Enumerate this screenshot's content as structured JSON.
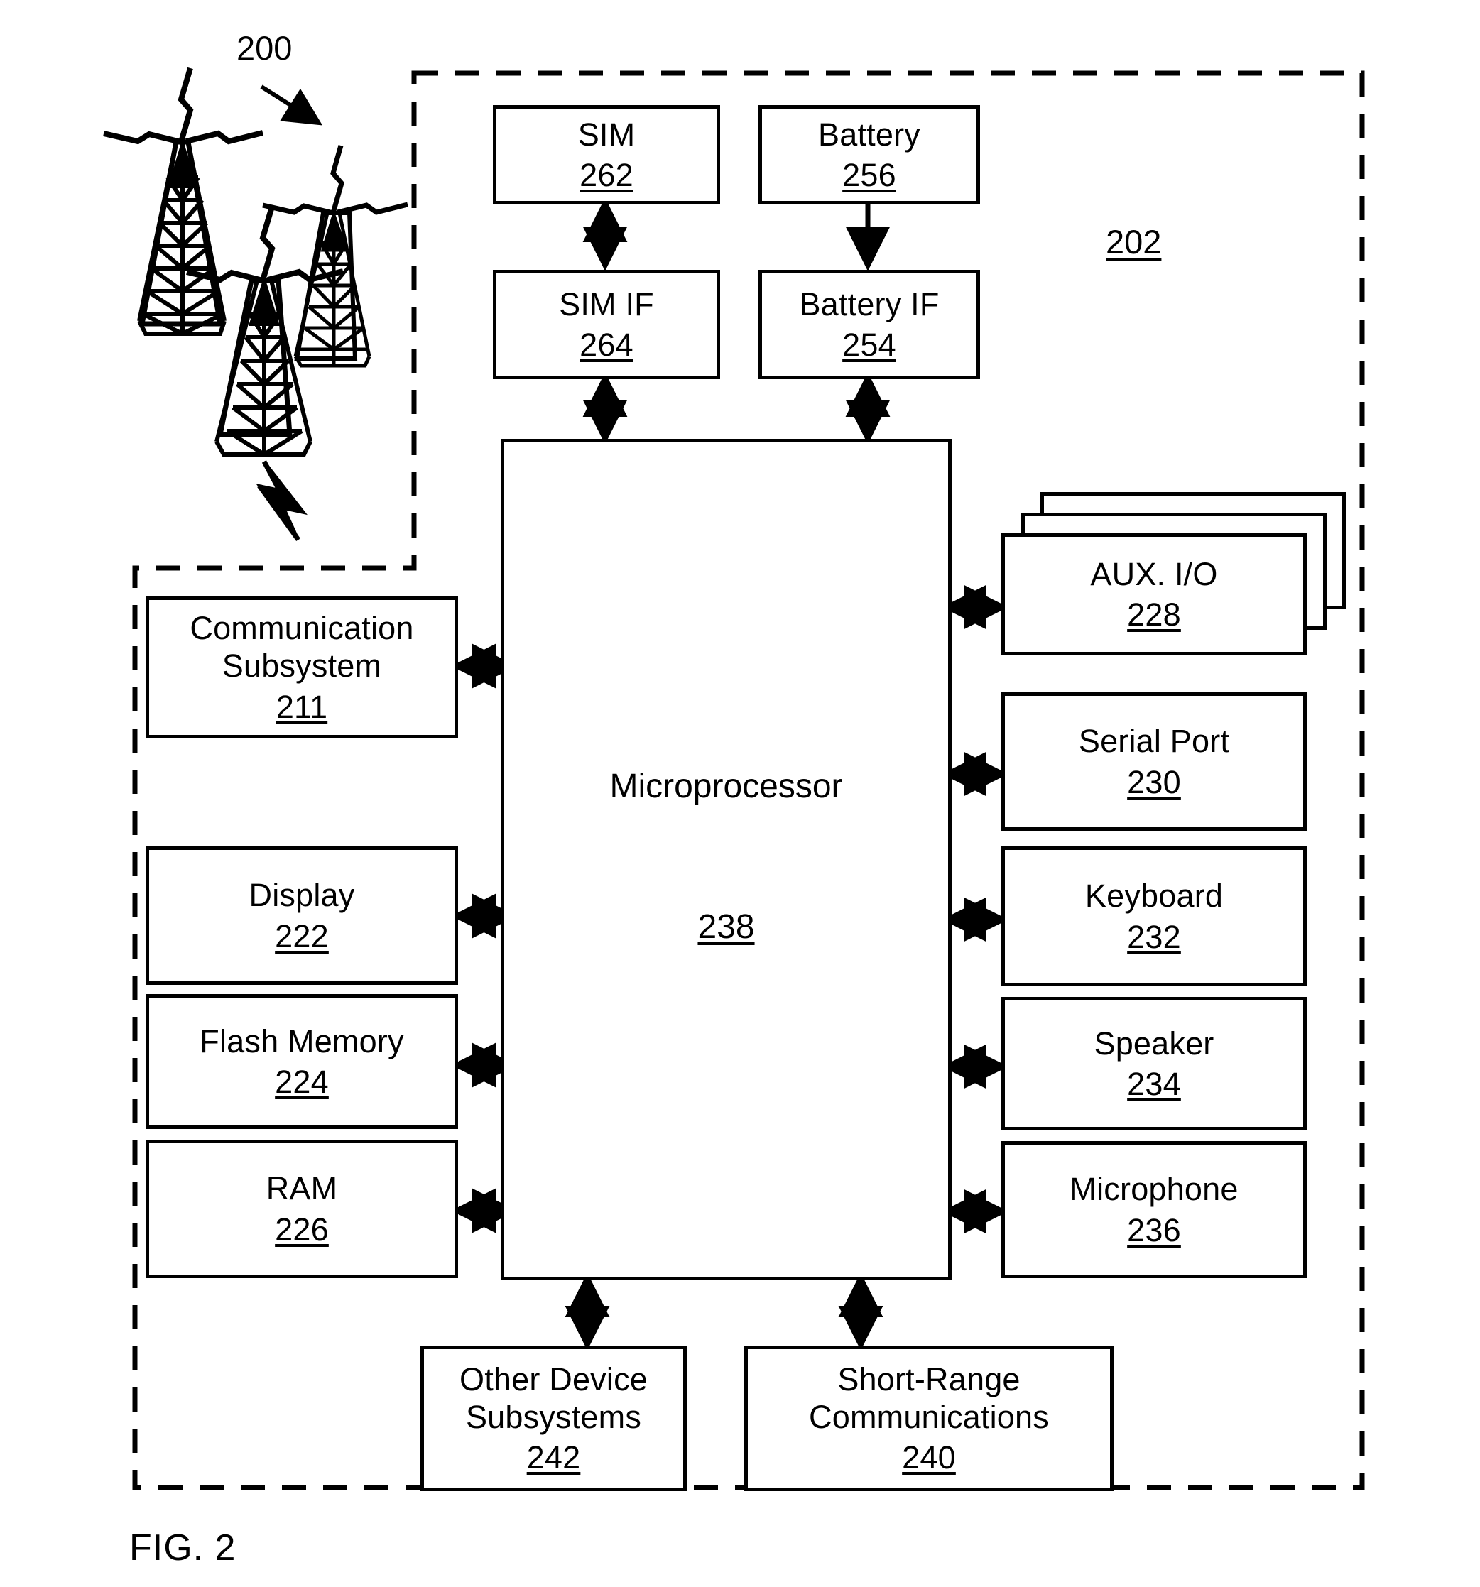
{
  "figure": {
    "caption": "FIG. 2",
    "system_label": "200",
    "device_label": "202",
    "background": "#ffffff",
    "ink": "#000000"
  },
  "towers": [
    {
      "name": "tower-large",
      "label": ""
    },
    {
      "name": "tower-medium",
      "label": ""
    },
    {
      "name": "tower-small",
      "label": ""
    }
  ],
  "blocks": {
    "sim": {
      "label": "SIM",
      "number": "262"
    },
    "battery": {
      "label": "Battery",
      "number": "256"
    },
    "sim_if": {
      "label": "SIM IF",
      "number": "264"
    },
    "battery_if": {
      "label": "Battery IF",
      "number": "254"
    },
    "comm": {
      "label": "Communication\nSubsystem",
      "number": "211"
    },
    "display": {
      "label": "Display",
      "number": "222"
    },
    "flash": {
      "label": "Flash Memory",
      "number": "224"
    },
    "ram": {
      "label": "RAM",
      "number": "226"
    },
    "aux": {
      "label": "AUX. I/O",
      "number": "228"
    },
    "serial": {
      "label": "Serial Port",
      "number": "230"
    },
    "keyboard": {
      "label": "Keyboard",
      "number": "232"
    },
    "speaker": {
      "label": "Speaker",
      "number": "234"
    },
    "microphone": {
      "label": "Microphone",
      "number": "236"
    },
    "other": {
      "label": "Other Device\nSubsystems",
      "number": "242"
    },
    "shortrange": {
      "label": "Short-Range\nCommunications",
      "number": "240"
    },
    "micro": {
      "label": "Microprocessor",
      "number": "238"
    }
  }
}
